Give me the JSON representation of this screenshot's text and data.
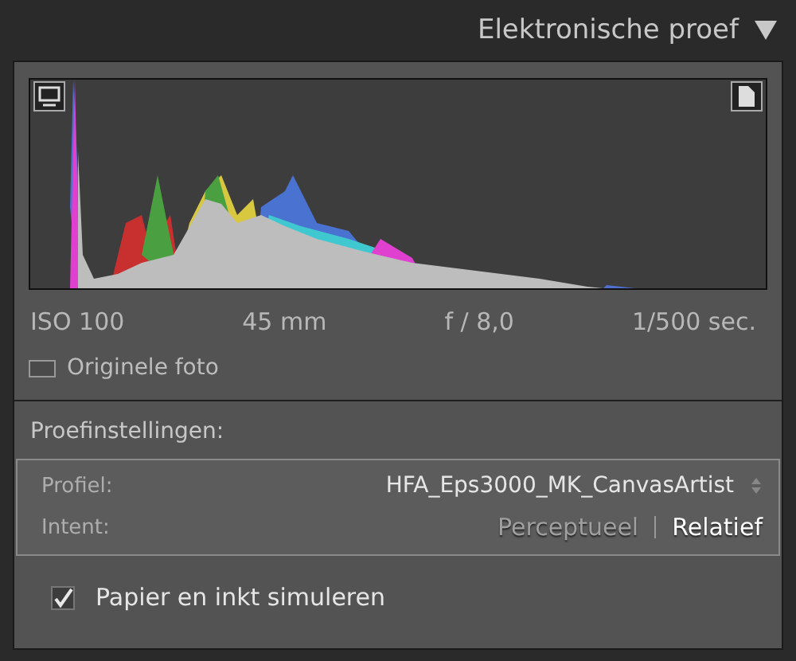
{
  "panel": {
    "title": "Elektronische proef",
    "expanded": true
  },
  "histogram": {
    "exif": [
      "ISO 100",
      "45 mm",
      "f / 8,0",
      "1/500 sec."
    ]
  },
  "original_photo": {
    "label": "Originele foto",
    "checked": false
  },
  "settings": {
    "heading": "Proefinstellingen:",
    "profile": {
      "label": "Profiel:",
      "value": "HFA_Eps3000_MK_CanvasArtist"
    },
    "intent": {
      "label": "Intent:",
      "options": [
        {
          "label": "Perceptueel",
          "selected": false
        },
        {
          "label": "Relatief",
          "selected": true
        }
      ]
    }
  },
  "simulate": {
    "label": "Papier en inkt simuleren",
    "checked": true
  }
}
